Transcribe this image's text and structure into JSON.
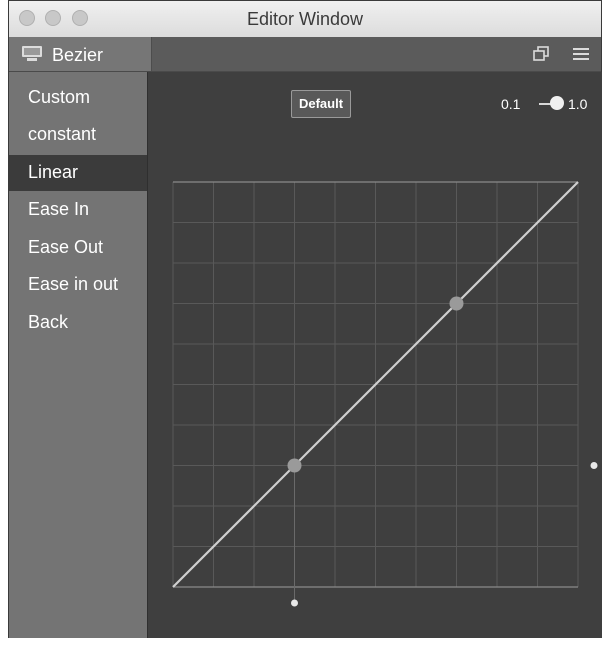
{
  "window": {
    "title": "Editor Window"
  },
  "tab": {
    "label": "Bezier",
    "icon": "display-icon"
  },
  "toolbar": {
    "icons": [
      "restore-window-icon",
      "menu-icon"
    ]
  },
  "sidebar": {
    "items": [
      {
        "label": "Custom"
      },
      {
        "label": "constant"
      },
      {
        "label": "Linear",
        "selected": true
      },
      {
        "label": "Ease In"
      },
      {
        "label": "Ease Out"
      },
      {
        "label": "Ease in out"
      },
      {
        "label": "Back"
      }
    ]
  },
  "editor": {
    "default_label": "Default",
    "zoom": {
      "min_label": "0.1",
      "max_label": "1.0",
      "value": 1.0
    },
    "curve": {
      "type": "linear",
      "control_point_1": [
        0.3,
        0.3
      ],
      "control_point_2": [
        0.7,
        0.7
      ],
      "grid_divisions": 10
    }
  },
  "colors": {
    "window_bg": "#5a5a5a",
    "sidebar_bg": "#747474",
    "selected_bg": "#3b3b3b",
    "editor_bg": "#3f3f3f",
    "grid": "#595959",
    "curve": "#cfcfcf",
    "handle": "#9a9a9a"
  }
}
